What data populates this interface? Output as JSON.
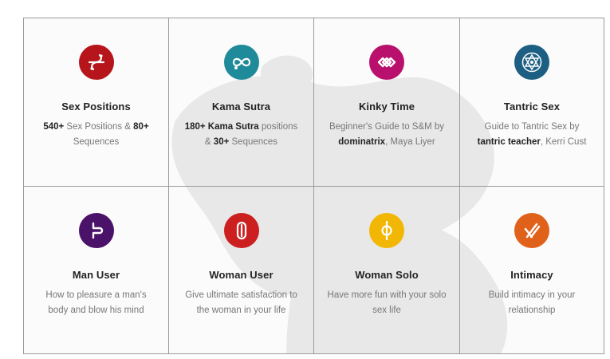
{
  "colors": {
    "sex_positions": "#b5151b",
    "kama_sutra": "#1f8a9a",
    "kinky_time": "#b8106c",
    "tantric_sex": "#1d5f82",
    "man_user": "#4b1269",
    "woman_user": "#cc1f1f",
    "woman_solo": "#f2b705",
    "intimacy": "#e0621a"
  },
  "cards": {
    "sex_positions": {
      "icon": "interlocking-bodies-icon",
      "title": "Sex Positions",
      "desc_a_bold": "540+",
      "desc_b": " Sex Positions & ",
      "desc_c_bold": "80+",
      "desc_d": " Sequences"
    },
    "kama_sutra": {
      "icon": "infinity-knot-icon",
      "title": "Kama Sutra",
      "desc_a_bold": "180+ Kama Sutra",
      "desc_b": " positions & ",
      "desc_c_bold": "30+",
      "desc_d": " Sequences"
    },
    "kinky_time": {
      "icon": "diamond-chain-icon",
      "title": "Kinky Time",
      "desc_a": "Beginner's Guide to S&M by ",
      "desc_b_bold": "dominatrix",
      "desc_c": ", Maya Liyer"
    },
    "tantric_sex": {
      "icon": "sri-yantra-icon",
      "title": "Tantric Sex",
      "desc_a": "Guide to Tantric Sex by ",
      "desc_b_bold": "tantric teacher",
      "desc_c": ", Kerri Cust"
    },
    "man_user": {
      "icon": "male-symbol-icon",
      "title": "Man User",
      "desc": "How to pleasure a man's body and blow his mind"
    },
    "woman_user": {
      "icon": "female-symbol-icon",
      "title": "Woman User",
      "desc": "Give ultimate satisfaction to the woman in your life"
    },
    "woman_solo": {
      "icon": "solo-circle-icon",
      "title": "Woman Solo",
      "desc": "Have more fun with your solo sex life"
    },
    "intimacy": {
      "icon": "crossed-lines-icon",
      "title": "Intimacy",
      "desc": "Build intimacy in your relationship"
    }
  }
}
